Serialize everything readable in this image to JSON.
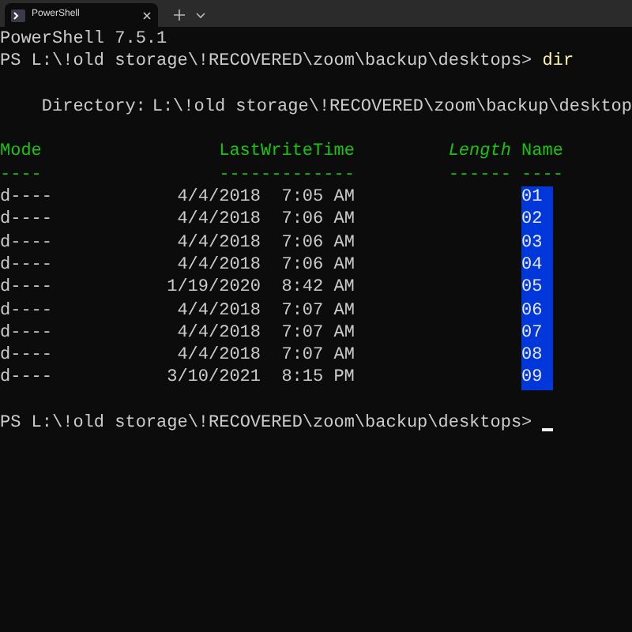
{
  "tab": {
    "title": "PowerShell"
  },
  "terminal": {
    "banner": "PowerShell 7.5.1",
    "prompt": {
      "text": "PS L:\\!old storage\\!RECOVERED\\zoom\\backup\\desktops>",
      "command": "dir"
    },
    "directory": {
      "label": "Directory:",
      "path": "L:\\!old storage\\!RECOVERED\\zoom\\backup\\desktop"
    },
    "columns": [
      {
        "label": "Mode",
        "rule": "----"
      },
      {
        "label": "LastWriteTime",
        "rule": "-------------"
      },
      {
        "label": "Length",
        "rule": "------"
      },
      {
        "label": "Name",
        "rule": "----"
      }
    ],
    "rows": [
      {
        "mode": "d----",
        "time": "4/4/2018  7:05 AM",
        "name": "01",
        "selected": true
      },
      {
        "mode": "d----",
        "time": "4/4/2018  7:06 AM",
        "name": "02",
        "selected": true
      },
      {
        "mode": "d----",
        "time": "4/4/2018  7:06 AM",
        "name": "03",
        "selected": true
      },
      {
        "mode": "d----",
        "time": "4/4/2018  7:06 AM",
        "name": "04",
        "selected": true
      },
      {
        "mode": "d----",
        "time": "1/19/2020  8:42 AM",
        "name": "05",
        "selected": true
      },
      {
        "mode": "d----",
        "time": "4/4/2018  7:07 AM",
        "name": "06",
        "selected": true
      },
      {
        "mode": "d----",
        "time": "4/4/2018  7:07 AM",
        "name": "07",
        "selected": true
      },
      {
        "mode": "d----",
        "time": "4/4/2018  7:07 AM",
        "name": "08",
        "selected": true
      },
      {
        "mode": "d----",
        "time": "3/10/2021  8:15 PM",
        "name": "09",
        "selected": true
      }
    ],
    "final_prompt": "PS L:\\!old storage\\!RECOVERED\\zoom\\backup\\desktops>"
  }
}
